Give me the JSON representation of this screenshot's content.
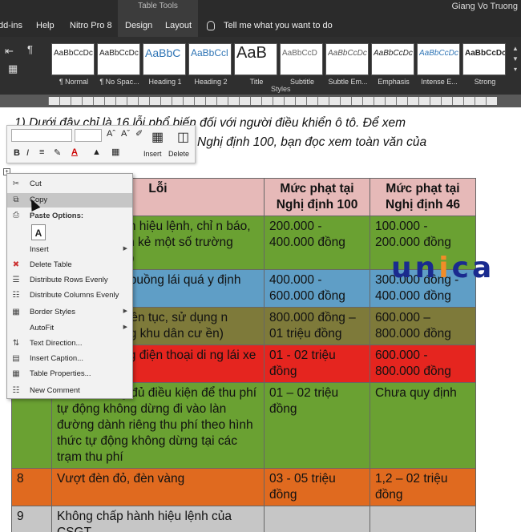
{
  "ribbon": {
    "context_tab_group": "Table Tools",
    "user": "Giang Vo Truong",
    "tabs": [
      "dd-ins",
      "Help",
      "Nitro Pro 8",
      "Design",
      "Layout"
    ],
    "tell_me": "Tell me what you want to do",
    "styles": [
      {
        "sample": "AaBbCcDc",
        "name": "¶ Normal"
      },
      {
        "sample": "AaBbCcDc",
        "name": "¶ No Spac..."
      },
      {
        "sample": "AaBbC",
        "name": "Heading 1"
      },
      {
        "sample": "AaBbCcl",
        "name": "Heading 2"
      },
      {
        "sample": "AaB",
        "name": "Title"
      },
      {
        "sample": "AaBbCcD",
        "name": "Subtitle"
      },
      {
        "sample": "AaBbCcDc",
        "name": "Subtle Em..."
      },
      {
        "sample": "AaBbCcDc",
        "name": "Emphasis"
      },
      {
        "sample": "AaBbCcDc",
        "name": "Intense E..."
      },
      {
        "sample": "AaBbCcDc",
        "name": "Strong"
      }
    ],
    "styles_group_label": "Styles"
  },
  "document": {
    "intro_line1": "1) Dưới đây chỉ là 16 lỗi phổ biến đối với người điều khiển ô tô. Để xem",
    "intro_line2": "Nghị định 100, bạn đọc xem toàn văn của",
    "table": {
      "headers": [
        "",
        "Lỗi",
        "Mức phạt tại Nghị định 100",
        "Mức phạt tại Nghị định 46"
      ],
      "rows": [
        {
          "stt": "",
          "loi": "hành hiệu lệnh, chỉ n báo, vạch kẻ một số trường hợp)",
          "m100": "200.000 - 400.000 đồng",
          "m46": "100.000 - 200.000 đồng",
          "color": "#6aa132"
        },
        {
          "stt": "",
          "loi": "rên buồng lái quá y định",
          "m100": "400.000 - 600.000 đồng",
          "m46": "300.000 đồng - 400.000 đồng",
          "color": "#5f9ec6"
        },
        {
          "stt": "",
          "loi": "ga liên tục, sử dụng n trong khu dân cư ền)",
          "m100": "800.000 đồng – 01 triệu đồng",
          "m46": "600.000 – 800.000 đồng",
          "color": "#7e7a3a"
        },
        {
          "stt": "",
          "loi": "dụng điện thoại di ng lái xe",
          "m100": "01 - 02 triệu đồng",
          "m46": "600.000 - 800.000 đồng",
          "color": "#e5251f"
        },
        {
          "stt": "7",
          "loi": "Lái xe không đủ điều kiện để thu phí tự động không dừng đi vào làn đường dành riêng thu phí theo hình thức tự động không dừng tại các trạm thu phí",
          "m100": "01 – 02 triệu đồng",
          "m46": "Chưa quy định",
          "color": "#6aa132"
        },
        {
          "stt": "8",
          "loi": "Vượt đèn đỏ, đèn vàng",
          "m100": "03 - 05 triệu đồng",
          "m46": "1,2 – 02 triệu đồng",
          "color": "#e06a1f"
        },
        {
          "stt": "9",
          "loi": "Không chấp hành hiệu lệnh của CSGT",
          "m100": "",
          "m46": "",
          "color": "#c6c6c6"
        }
      ]
    }
  },
  "logo": {
    "u": "u",
    "n": "n",
    "i": "i",
    "c": "c",
    "a": "a"
  },
  "mini_toolbar": {
    "insert": "Insert",
    "delete": "Delete",
    "bold": "B",
    "italic": "I",
    "align": "≡"
  },
  "context_menu": {
    "items": [
      {
        "label": "Cut",
        "icon": "✂",
        "name": "scissors-icon"
      },
      {
        "label": "Copy",
        "icon": "⧉",
        "name": "copy-icon"
      },
      {
        "label": "Paste Options:",
        "icon": "📋",
        "name": "clipboard-icon"
      },
      {
        "label": "Insert",
        "icon": "",
        "name": "insert-icon"
      },
      {
        "label": "Delete Table",
        "icon": "✖",
        "name": "delete-table-icon"
      },
      {
        "label": "Distribute Rows Evenly",
        "icon": "☰",
        "name": "distribute-rows-icon"
      },
      {
        "label": "Distribute Columns Evenly",
        "icon": "☷",
        "name": "distribute-columns-icon"
      },
      {
        "label": "Border Styles",
        "icon": "▦",
        "name": "border-styles-icon"
      },
      {
        "label": "AutoFit",
        "icon": "",
        "name": "autofit-icon"
      },
      {
        "label": "Text Direction...",
        "icon": "⇅",
        "name": "text-direction-icon"
      },
      {
        "label": "Insert Caption...",
        "icon": "▤",
        "name": "insert-caption-icon"
      },
      {
        "label": "Table Properties...",
        "icon": "▦",
        "name": "table-properties-icon"
      },
      {
        "label": "New Comment",
        "icon": "☷",
        "name": "new-comment-icon"
      }
    ],
    "paste_glyph": "A"
  }
}
